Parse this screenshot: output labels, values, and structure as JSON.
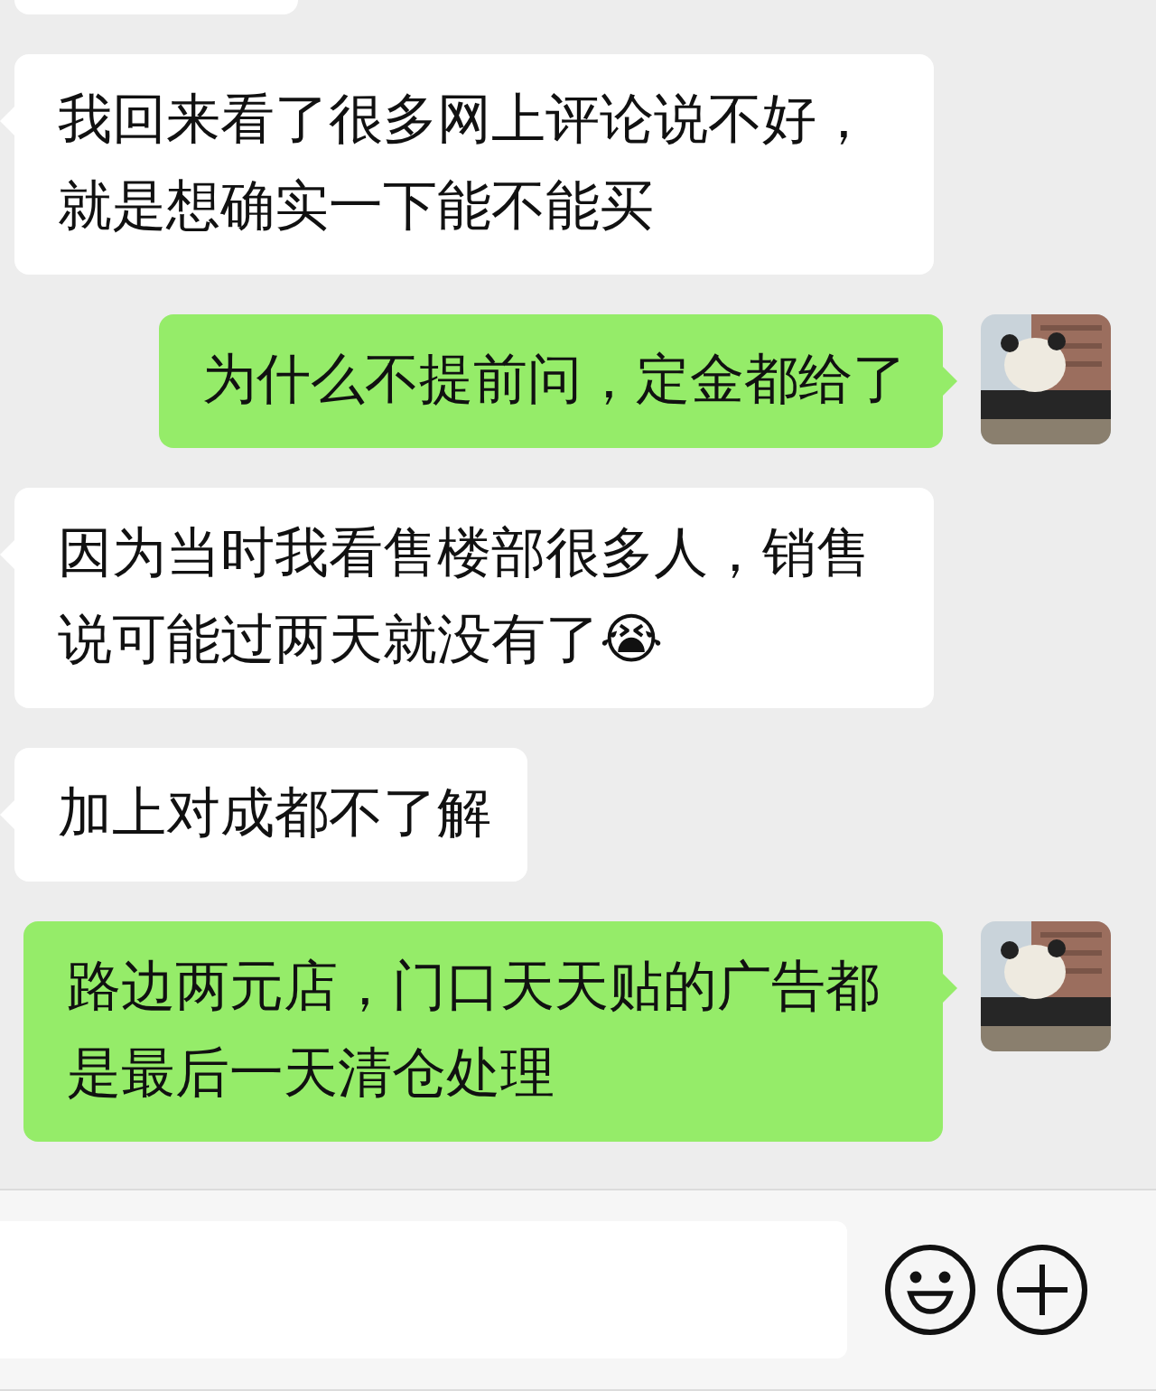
{
  "messages": [
    {
      "kind": "cut_off"
    },
    {
      "kind": "incoming",
      "text": "我回来看了很多网上评论说不好，就是想确实一下能不能买"
    },
    {
      "kind": "outgoing",
      "text": "为什么不提前问，定金都给了"
    },
    {
      "kind": "incoming",
      "text": "因为当时我看售楼部很多人，销售说可能过两天就没有了😭"
    },
    {
      "kind": "incoming",
      "text": "加上对成都不了解"
    },
    {
      "kind": "outgoing",
      "text": "路边两元店，门口天天贴的广告都是最后一天清仓处理"
    }
  ],
  "composer": {
    "buttons": [
      {
        "kind": "emoji"
      },
      {
        "kind": "plus"
      }
    ]
  }
}
